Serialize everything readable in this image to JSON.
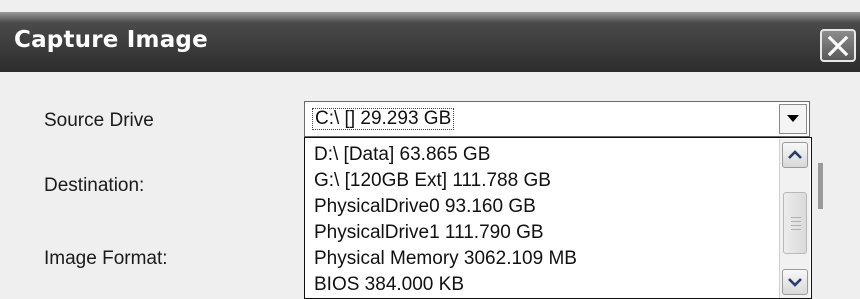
{
  "window": {
    "title": "Capture Image"
  },
  "form": {
    "source_drive_label": "Source Drive",
    "destination_label": "Destination:",
    "image_format_label": "Image Format:"
  },
  "source_drive": {
    "selected": "C:\\ [] 29.293 GB",
    "options": [
      "D:\\ [Data] 63.865 GB",
      "G:\\ [120GB Ext] 111.788 GB",
      "PhysicalDrive0 93.160 GB",
      "PhysicalDrive1 111.790 GB",
      "Physical Memory 3062.109 MB",
      "BIOS 384.000 KB"
    ]
  },
  "icons": {
    "close": "close-icon",
    "dropdown": "chevron-down-icon",
    "scroll_up": "chevron-up-icon",
    "scroll_down": "chevron-down-icon"
  }
}
